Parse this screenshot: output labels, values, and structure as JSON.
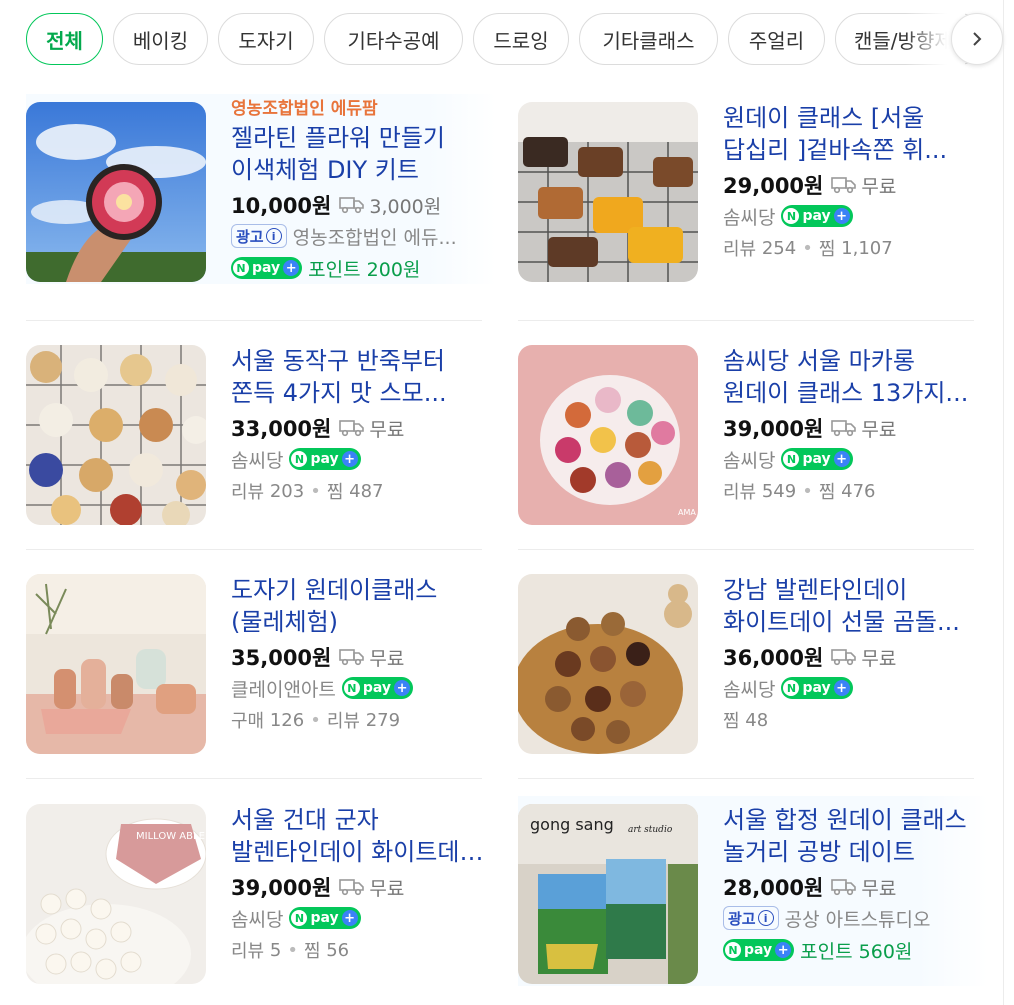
{
  "tabs": [
    {
      "label": "전체",
      "active": true
    },
    {
      "label": "베이킹"
    },
    {
      "label": "도자기"
    },
    {
      "label": "기타수공예"
    },
    {
      "label": "드로잉"
    },
    {
      "label": "기타클래스"
    },
    {
      "label": "주얼리"
    },
    {
      "label": "캔들/방향제"
    }
  ],
  "products": [
    {
      "advertiser": "영농조합법인 에듀팜",
      "title": "젤라틴 플라워 만들기 이색체험 DIY 키트",
      "price": "10,000원",
      "shipping": "3,000원",
      "ad_label": "광고",
      "seller": "영농조합법인 에듀...",
      "point": "포인트 200원",
      "image": "gelatin-flower-kit-photo"
    },
    {
      "title": "원데이 클래스 [서울 답십리 ]겉바속쫀 휘...",
      "price": "29,000원",
      "shipping": "무료",
      "seller": "솜씨당",
      "review_label": "리뷰",
      "review_count": "254",
      "zzim_label": "찜",
      "zzim_count": "1,107",
      "image": "pound-cake-photo"
    },
    {
      "title": "서울 동작구 반죽부터 쫀득 4가지 맛 스모...",
      "price": "33,000원",
      "shipping": "무료",
      "seller": "솜씨당",
      "review_label": "리뷰",
      "review_count": "203",
      "zzim_label": "찜",
      "zzim_count": "487",
      "image": "character-cookies-photo"
    },
    {
      "title": "솜씨당 서울 마카롱 원데이 클래스 13가지...",
      "price": "39,000원",
      "shipping": "무료",
      "seller": "솜씨당",
      "review_label": "리뷰",
      "review_count": "549",
      "zzim_label": "찜",
      "zzim_count": "476",
      "image": "macaron-photo"
    },
    {
      "title": "도자기 원데이클래스 (물레체험)",
      "price": "35,000원",
      "shipping": "무료",
      "seller": "클레이앤아트",
      "buy_label": "구매",
      "buy_count": "126",
      "review_label": "리뷰",
      "review_count": "279",
      "image": "pottery-photo"
    },
    {
      "title": "강남 발렌타인데이 화이트데이 선물 곰돌...",
      "price": "36,000원",
      "shipping": "무료",
      "seller": "솜씨당",
      "zzim_label": "찜",
      "zzim_count": "48",
      "image": "bear-chocolate-photo"
    },
    {
      "title": "서울 건대 군자 발렌타인데이 화이트데이 ...",
      "price": "39,000원",
      "shipping": "무료",
      "seller": "솜씨당",
      "review_label": "리뷰",
      "review_count": "5",
      "zzim_label": "찜",
      "zzim_count": "56",
      "image": "heart-cake-photo"
    },
    {
      "title": "서울 합정 원데이 클래스 놀거리 공방 데이트",
      "price": "28,000원",
      "shipping": "무료",
      "ad_label": "광고",
      "seller": "공상 아트스튜디오",
      "point": "포인트 560원",
      "image": "art-studio-photo"
    }
  ],
  "npay_label": "pay",
  "npay_n": "N",
  "next_icon": "chevron-right-icon",
  "image_texts": {
    "gong_sang": "gong sang",
    "art_studio": "art studio",
    "cake_text": "MILLOW ABLE"
  },
  "colors": {
    "accent": "#03c75a",
    "title_blue": "#1a3fa8",
    "advertiser_orange": "#e8743b"
  }
}
